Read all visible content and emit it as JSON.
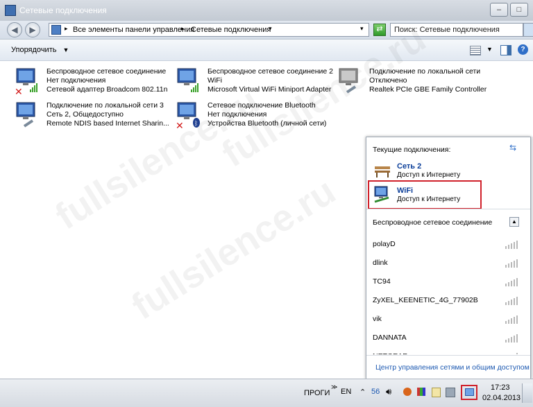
{
  "window": {
    "title": "Сетевые подключения"
  },
  "address": {
    "crumbs": [
      "Все элементы панели управления",
      "Сетевые подключения"
    ]
  },
  "search": {
    "placeholder": "Поиск: Сетевые подключения"
  },
  "toolbar": {
    "organize_label": "Упорядочить"
  },
  "connections": [
    {
      "name": "Беспроводное сетевое соединение",
      "status": "Нет подключения",
      "device": "Сетевой адаптер Broadcom 802.11n",
      "icon": "wireless-network-icon",
      "disconnected": true
    },
    {
      "name": "Беспроводное сетевое соединение 2",
      "status": "WiFi",
      "device": "Microsoft Virtual WiFi Miniport Adapter",
      "icon": "wireless-network-icon",
      "disconnected": false
    },
    {
      "name": "Подключение по локальной сети",
      "status": "Отключено",
      "device": "Realtek PCIe GBE Family Controller",
      "icon": "lan-network-icon",
      "disconnected": false
    },
    {
      "name": "Подключение по локальной сети 3",
      "status": "Сеть  2, Общедоступно",
      "device": "Remote NDIS based Internet Sharin...",
      "icon": "lan-network-icon",
      "disconnected": false
    },
    {
      "name": "Сетевое подключение Bluetooth",
      "status": "Нет подключения",
      "device": "Устройства Bluetooth (личной сети)",
      "icon": "bluetooth-network-icon",
      "disconnected": true
    }
  ],
  "popup": {
    "header": "Текущие подключения:",
    "current": [
      {
        "name": "Сеть  2",
        "status": "Доступ к Интернету",
        "icon": "bench-network-icon"
      },
      {
        "name": "WiFi",
        "status": "Доступ к Интернету",
        "icon": "monitor-network-icon"
      }
    ],
    "section_title": "Беспроводное сетевое соединение",
    "networks": [
      "polayD",
      "dlink",
      "TC94",
      "ZyXEL_KEENETIC_4G_77902B",
      "vik",
      "DANNATA",
      "NETGEAR"
    ],
    "footer_link": "Центр управления сетями и общим доступом"
  },
  "watermark": "fullsilence.ru",
  "taskbar": {
    "program": "ПРОГИ",
    "lang": "EN",
    "counter": "56",
    "time": "17:23",
    "date": "02.04.2013"
  },
  "colors": {
    "highlight_box": "#d0202a",
    "link": "#1a57b0",
    "bold_name": "#0b3e99"
  }
}
